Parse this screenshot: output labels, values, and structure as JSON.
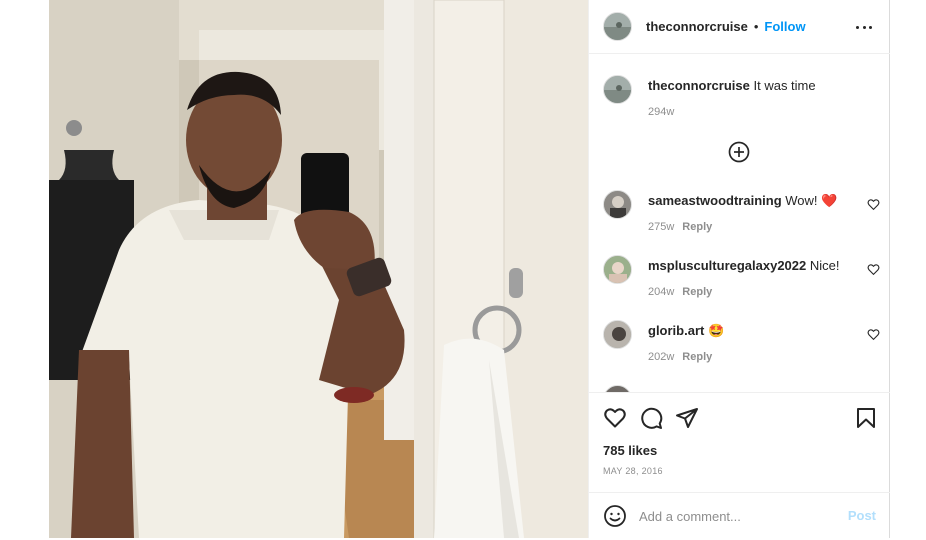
{
  "header": {
    "username": "theconnorcruise",
    "separator": "•",
    "follow_label": "Follow"
  },
  "caption": {
    "username": "theconnorcruise",
    "text": "It was time",
    "age": "294w"
  },
  "comments": [
    {
      "username": "sameastwoodtraining",
      "text": "Wow! ❤️",
      "age": "275w",
      "reply_label": "Reply"
    },
    {
      "username": "msplusculturegalaxy2022",
      "text": "Nice!",
      "age": "204w",
      "reply_label": "Reply"
    },
    {
      "username": "glorib.art",
      "text": "🤩",
      "age": "202w",
      "reply_label": "Reply"
    }
  ],
  "actions": {
    "likes": "785 likes",
    "date": "MAY 28, 2016"
  },
  "add_comment": {
    "placeholder": "Add a comment...",
    "post_label": "Post"
  },
  "icons": [
    "more-options-icon",
    "load-more-icon",
    "heart-icon",
    "comment-icon",
    "share-icon",
    "bookmark-icon",
    "emoji-icon"
  ],
  "colors": {
    "accent": "#0095f6",
    "post_disabled": "#b2dffc",
    "text": "#262626",
    "muted": "#8e8e8e"
  }
}
